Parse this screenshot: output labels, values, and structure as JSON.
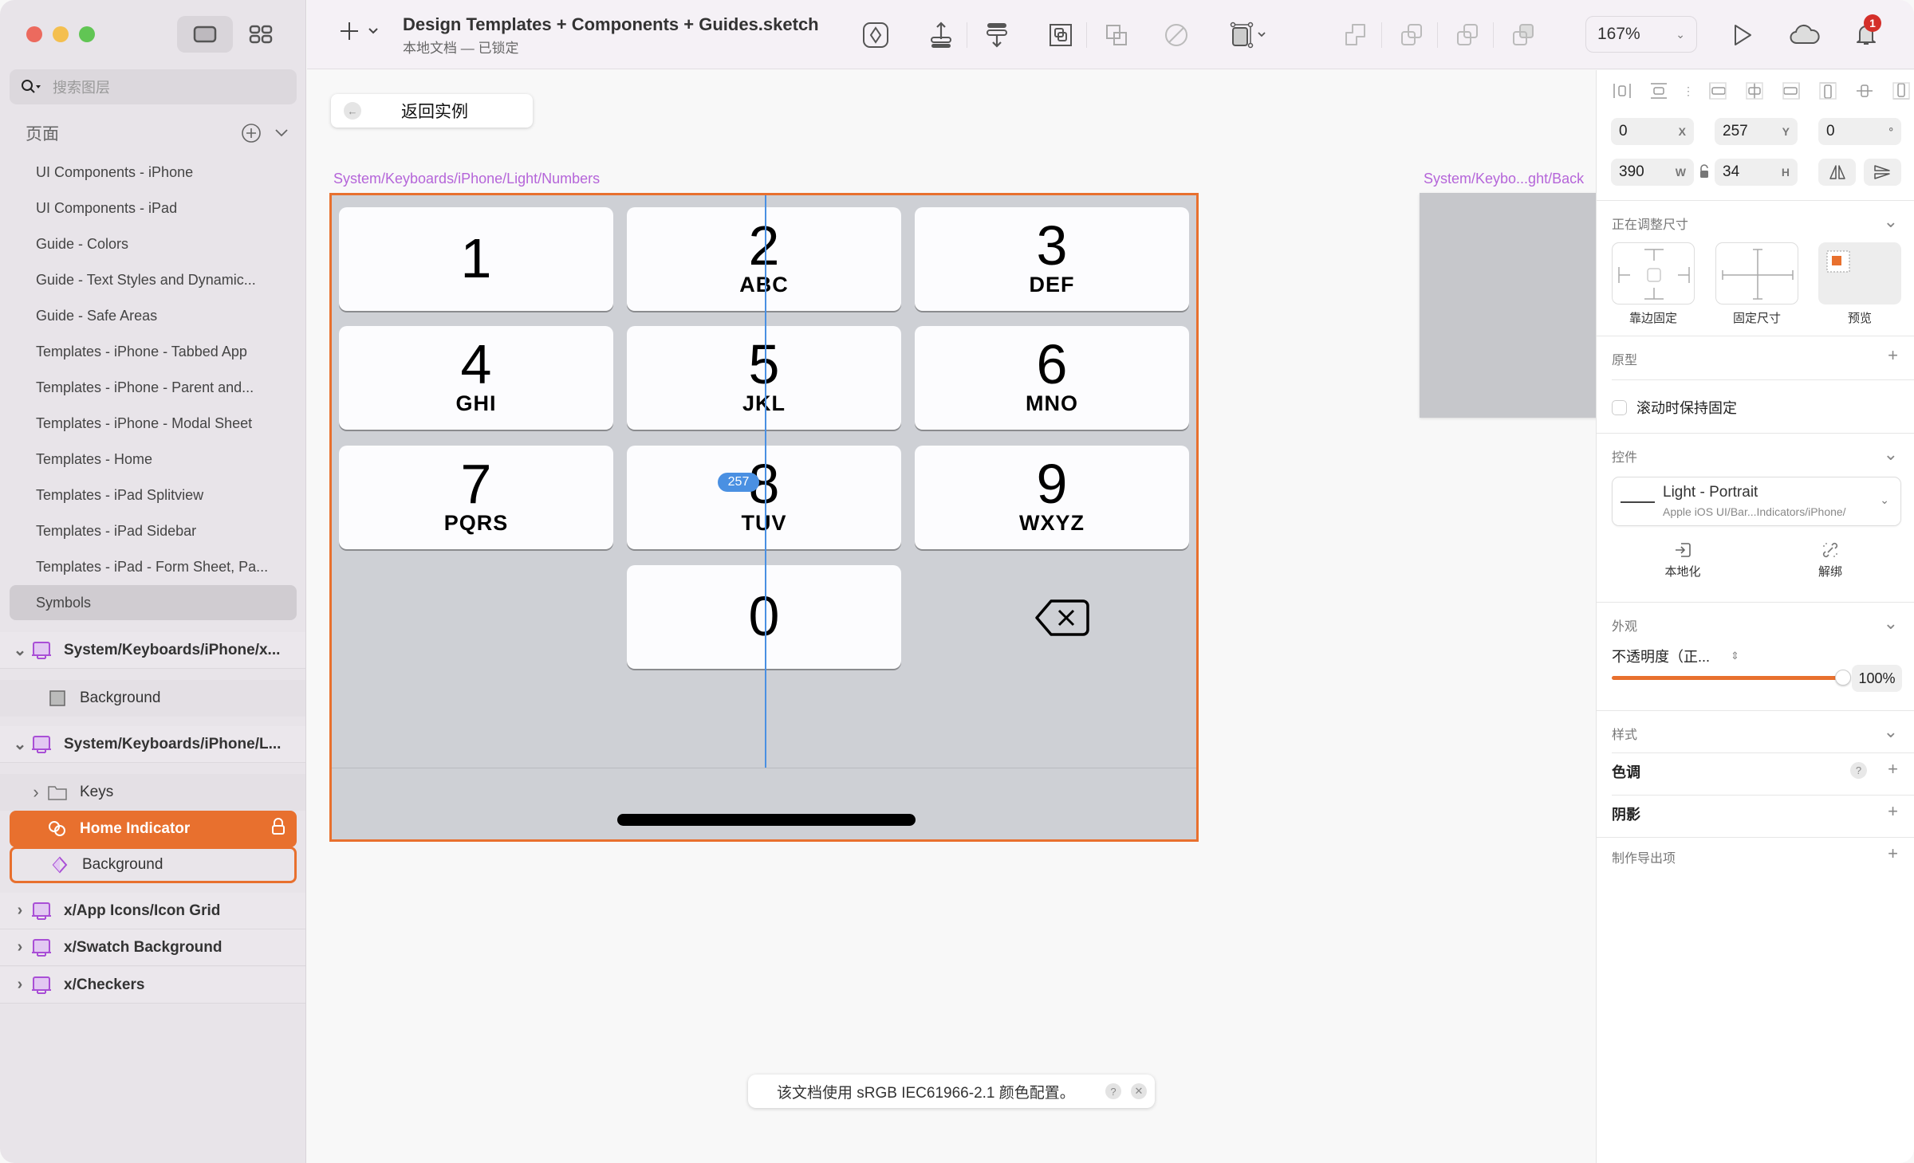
{
  "window": {
    "view_modes": [
      "canvas-view",
      "components-view"
    ]
  },
  "sidebar": {
    "search_placeholder": "搜索图层",
    "pages_title": "页面",
    "pages": [
      {
        "label": "UI Components - iPhone"
      },
      {
        "label": "UI Components - iPad"
      },
      {
        "label": "Guide - Colors"
      },
      {
        "label": "Guide - Text Styles and Dynamic..."
      },
      {
        "label": "Guide - Safe Areas"
      },
      {
        "label": "Templates - iPhone - Tabbed App"
      },
      {
        "label": "Templates - iPhone - Parent and..."
      },
      {
        "label": "Templates - iPhone - Modal Sheet"
      },
      {
        "label": "Templates - Home"
      },
      {
        "label": "Templates - iPad Splitview"
      },
      {
        "label": "Templates - iPad Sidebar"
      },
      {
        "label": "Templates - iPad - Form Sheet, Pa..."
      },
      {
        "label": "Symbols",
        "selected": true
      }
    ],
    "layers": [
      {
        "label": "System/Keyboards/iPhone/x...",
        "type": "symbol-master",
        "expanded": true
      },
      {
        "label": "Background",
        "type": "rectangle"
      },
      {
        "label": "System/Keyboards/iPhone/L...",
        "type": "symbol-master",
        "expanded": true
      },
      {
        "label": "Keys",
        "type": "folder"
      },
      {
        "label": "Home Indicator",
        "type": "symbol-instance",
        "selected": true,
        "locked": true
      },
      {
        "label": "Background",
        "type": "symbol-instance",
        "hovered": true
      },
      {
        "label": "x/App Icons/Icon Grid",
        "type": "symbol-master"
      },
      {
        "label": "x/Swatch Background",
        "type": "symbol-master"
      },
      {
        "label": "x/Checkers",
        "type": "symbol-master"
      }
    ]
  },
  "toolbar": {
    "doc_title": "Design Templates + Components + Guides.sketch",
    "doc_subtitle": "本地文档 — 已锁定",
    "zoom": "167%",
    "notification_count": "1"
  },
  "canvas": {
    "back_button": "返回实例",
    "artboard_label": "System/Keyboards/iPhone/Light/Numbers",
    "artboard2_label": "System/Keybo...ght/Back",
    "guide_value": "257",
    "keys": [
      {
        "num": "1",
        "letters": ""
      },
      {
        "num": "2",
        "letters": "ABC"
      },
      {
        "num": "3",
        "letters": "DEF"
      },
      {
        "num": "4",
        "letters": "GHI"
      },
      {
        "num": "5",
        "letters": "JKL"
      },
      {
        "num": "6",
        "letters": "MNO"
      },
      {
        "num": "7",
        "letters": "PQRS"
      },
      {
        "num": "8",
        "letters": "TUV"
      },
      {
        "num": "9",
        "letters": "WXYZ"
      },
      {
        "num": "0",
        "letters": ""
      }
    ],
    "toast": "该文档使用 sRGB IEC61966-2.1 颜色配置。"
  },
  "inspector": {
    "x": "0",
    "x_unit": "X",
    "y": "257",
    "y_unit": "Y",
    "rotation": "0",
    "rotation_unit": "°",
    "w": "390",
    "w_unit": "W",
    "h": "34",
    "h_unit": "H",
    "resizing_title": "正在调整尺寸",
    "resize_options": [
      "靠边固定",
      "固定尺寸",
      "预览"
    ],
    "prototype_title": "原型",
    "fix_on_scroll": "滚动时保持固定",
    "component_title": "控件",
    "component_name": "Light - Portrait",
    "component_path": "Apple iOS UI/Bar...Indicators/iPhone/",
    "detach_actions": [
      "本地化",
      "解绑"
    ],
    "appearance_title": "外观",
    "opacity_label": "不透明度（正...",
    "opacity_value": "100%",
    "opacity_fraction": 1.0,
    "style_title": "样式",
    "tint_label": "色调",
    "shadow_label": "阴影",
    "export_label": "制作导出项"
  },
  "colors": {
    "accent": "#e8702e",
    "artboard_label": "#b565d9",
    "guide": "#4a90e2",
    "keyboard_bg": "#ced0d5"
  }
}
